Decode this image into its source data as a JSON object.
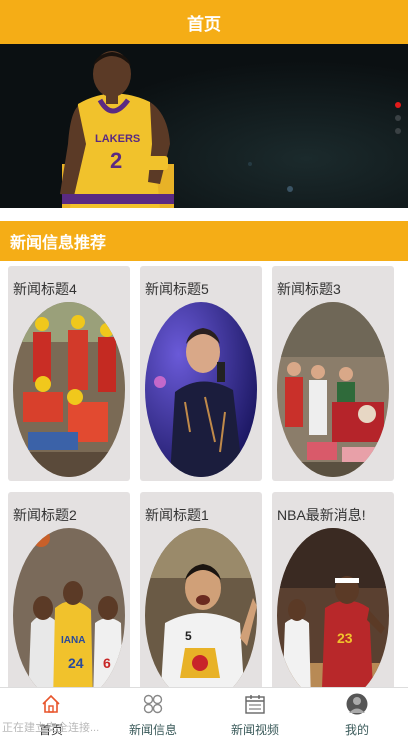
{
  "header": {
    "title": "首页"
  },
  "banner": {
    "active_index": 0,
    "dot_count": 3,
    "jersey_text": "LAKERS"
  },
  "section": {
    "title": "新闻信息推荐"
  },
  "news": [
    {
      "title": "新闻标题4"
    },
    {
      "title": "新闻标题5"
    },
    {
      "title": "新闻标题3"
    },
    {
      "title": "新闻标题2"
    },
    {
      "title": "新闻标题1"
    },
    {
      "title": "NBA最新消息!"
    }
  ],
  "tabbar": {
    "items": [
      {
        "label": "首页",
        "icon": "home-icon"
      },
      {
        "label": "新闻信息",
        "icon": "grid-icon"
      },
      {
        "label": "新闻视频",
        "icon": "calendar-icon"
      },
      {
        "label": "我的",
        "icon": "user-icon"
      }
    ],
    "active": 0
  },
  "status": {
    "text": "正在建立安全连接..."
  },
  "colors": {
    "accent": "#f5ad16",
    "active_dot": "#e21b1b",
    "card_bg": "#e4e1e1"
  }
}
